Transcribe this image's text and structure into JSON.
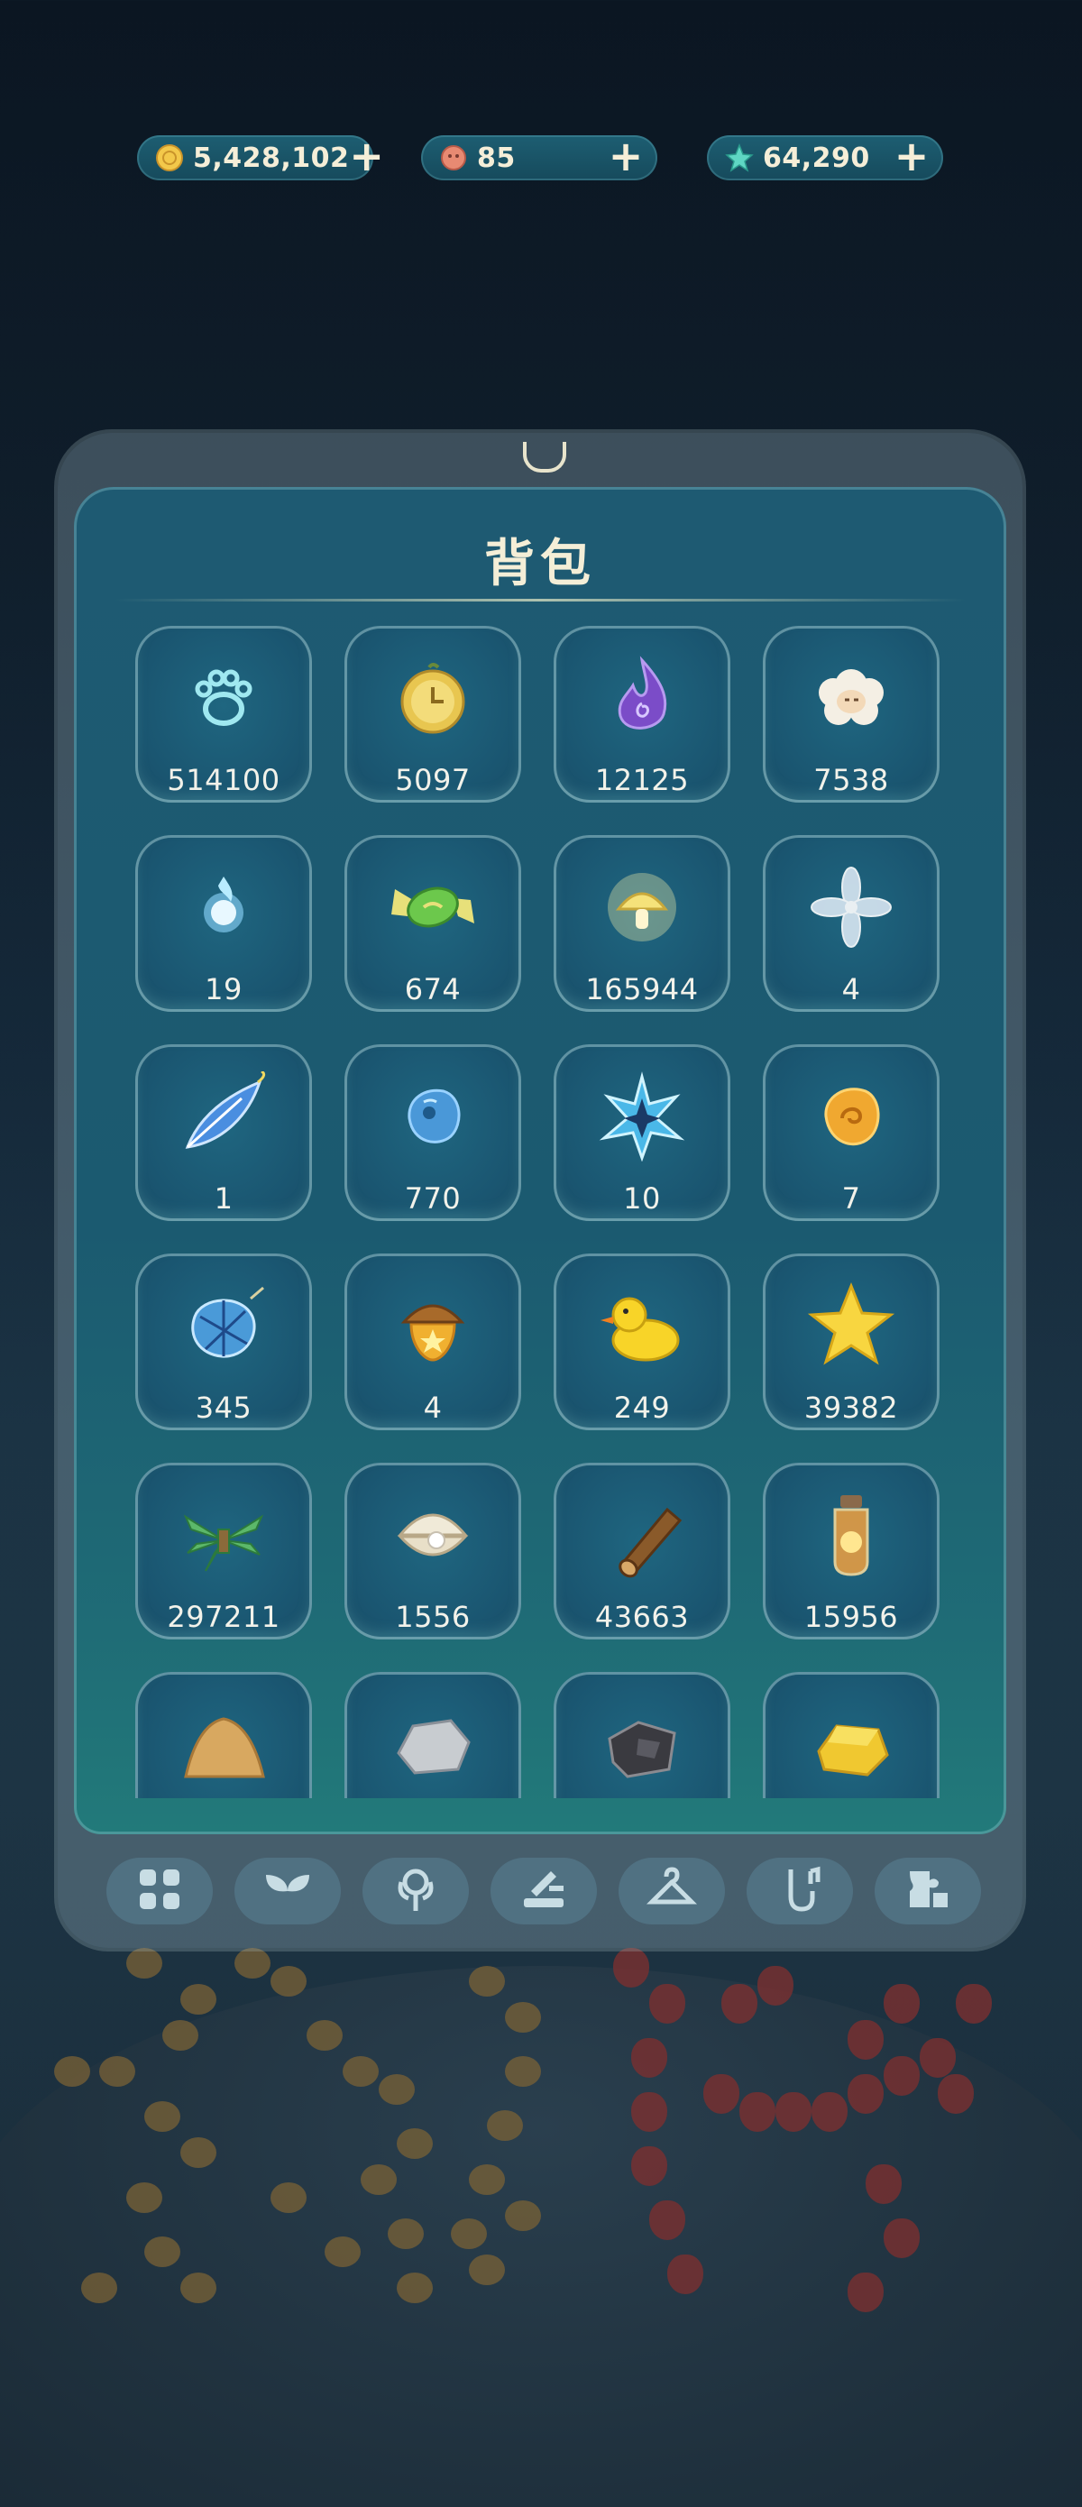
{
  "currencies": [
    {
      "name": "coin",
      "value": "5,428,102",
      "icon": "gold-coin-icon",
      "color": "#f3c84a"
    },
    {
      "name": "token",
      "value": "85",
      "icon": "pink-token-icon",
      "color": "#e88a72"
    },
    {
      "name": "gem",
      "value": "64,290",
      "icon": "star-gem-icon",
      "color": "#5fd6c4"
    }
  ],
  "backpack": {
    "title": "背包",
    "items": [
      {
        "count": "514100",
        "icon": "paw-print-icon"
      },
      {
        "count": "5097",
        "icon": "golden-clock-icon"
      },
      {
        "count": "12125",
        "icon": "purple-flame-icon"
      },
      {
        "count": "7538",
        "icon": "sheep-icon"
      },
      {
        "count": "19",
        "icon": "blue-spirit-orb-icon"
      },
      {
        "count": "674",
        "icon": "green-candy-icon"
      },
      {
        "count": "165944",
        "icon": "glowing-mushroom-icon"
      },
      {
        "count": "4",
        "icon": "crystal-flower-icon"
      },
      {
        "count": "1",
        "icon": "blue-feather-icon"
      },
      {
        "count": "770",
        "icon": "blue-slime-gem-icon"
      },
      {
        "count": "10",
        "icon": "ice-star-crystal-icon"
      },
      {
        "count": "7",
        "icon": "amber-stone-icon"
      },
      {
        "count": "345",
        "icon": "fishing-net-icon"
      },
      {
        "count": "4",
        "icon": "star-acorn-icon"
      },
      {
        "count": "249",
        "icon": "rubber-duck-icon"
      },
      {
        "count": "39382",
        "icon": "yellow-star-icon"
      },
      {
        "count": "297211",
        "icon": "grass-bundle-icon"
      },
      {
        "count": "1556",
        "icon": "pearl-shell-icon"
      },
      {
        "count": "43663",
        "icon": "wood-log-icon"
      },
      {
        "count": "15956",
        "icon": "firefly-jar-icon"
      },
      {
        "count": "",
        "icon": "sand-pile-icon"
      },
      {
        "count": "",
        "icon": "stone-icon"
      },
      {
        "count": "",
        "icon": "iron-ore-icon"
      },
      {
        "count": "",
        "icon": "gold-ingot-icon"
      }
    ]
  },
  "tabs": [
    {
      "name": "all",
      "icon": "grid-icon"
    },
    {
      "name": "plants",
      "icon": "sprout-icon"
    },
    {
      "name": "flower",
      "icon": "flower-icon"
    },
    {
      "name": "tools",
      "icon": "tools-icon"
    },
    {
      "name": "clothing",
      "icon": "hanger-icon"
    },
    {
      "name": "music",
      "icon": "saxophone-icon"
    },
    {
      "name": "misc",
      "icon": "puzzle-icon"
    }
  ]
}
